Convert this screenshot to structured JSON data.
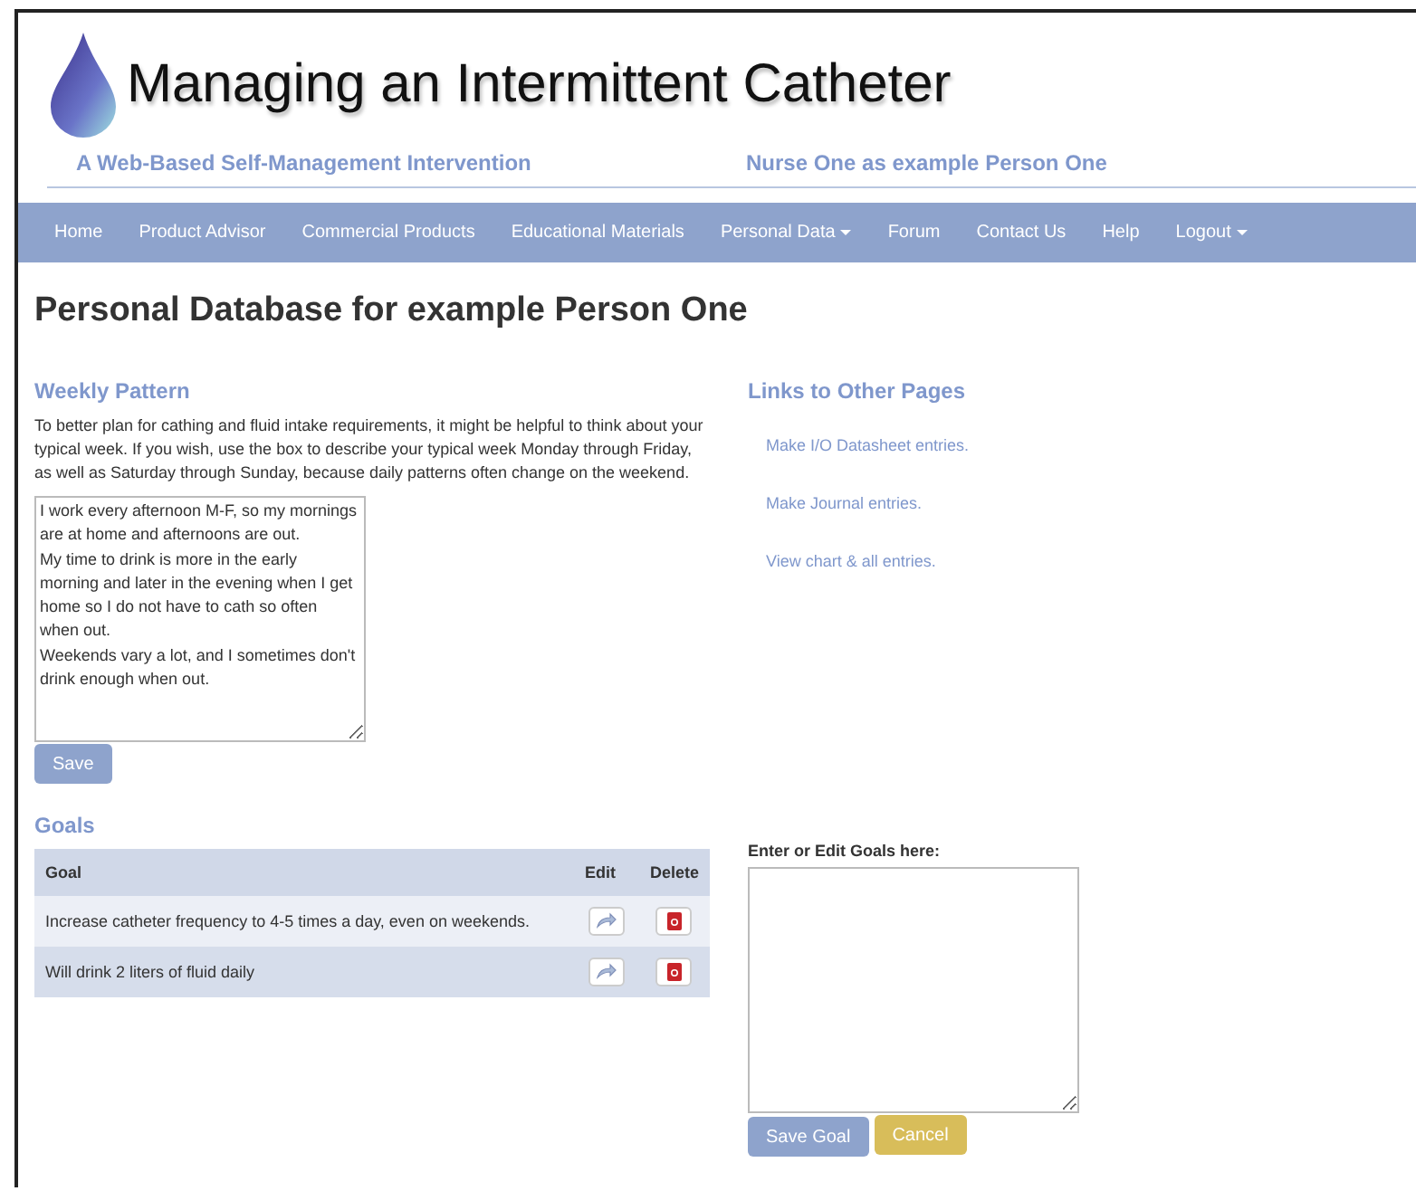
{
  "header": {
    "title": "Managing an Intermittent Catheter",
    "subtitle": "A Web-Based Self-Management Intervention",
    "user": "Nurse One as example Person One"
  },
  "nav": [
    {
      "label": "Home",
      "dropdown": false
    },
    {
      "label": "Product Advisor",
      "dropdown": false
    },
    {
      "label": "Commercial Products",
      "dropdown": false
    },
    {
      "label": "Educational Materials",
      "dropdown": false
    },
    {
      "label": "Personal Data",
      "dropdown": true
    },
    {
      "label": "Forum",
      "dropdown": false
    },
    {
      "label": "Contact Us",
      "dropdown": false
    },
    {
      "label": "Help",
      "dropdown": false
    },
    {
      "label": "Logout",
      "dropdown": true
    }
  ],
  "page_title": "Personal Database for example Person One",
  "weekly_pattern": {
    "heading": "Weekly Pattern",
    "intro": "To better plan for cathing and fluid intake requirements, it might be helpful to think about your typical week. If you wish, use the box to describe your typical week Monday through Friday, as well as Saturday through Sunday, because daily patterns often change on the weekend.",
    "value": "I work every afternoon M-F, so my mornings are at home and afternoons are out.\nMy time to drink is more in the early morning and later in the evening when I get home so I do not have to cath so often when out.\nWeekends vary a lot, and I sometimes don't drink enough when out.",
    "button": "Save"
  },
  "links": {
    "heading": "Links to Other Pages",
    "items": [
      "Make I/O Datasheet entries.",
      "Make Journal entries.",
      "View chart & all entries."
    ]
  },
  "goals": {
    "heading": "Goals",
    "columns": [
      "Goal",
      "Edit",
      "Delete"
    ],
    "rows": [
      "Increase catheter frequency to 4-5 times a day, even on weekends.",
      "Will drink 2 liters of fluid daily"
    ]
  },
  "goal_editor": {
    "label": "Enter or Edit Goals here:",
    "buttons": [
      {
        "label": "Save Goal",
        "kind": "primary"
      },
      {
        "label": "Cancel",
        "kind": "warning"
      }
    ]
  }
}
